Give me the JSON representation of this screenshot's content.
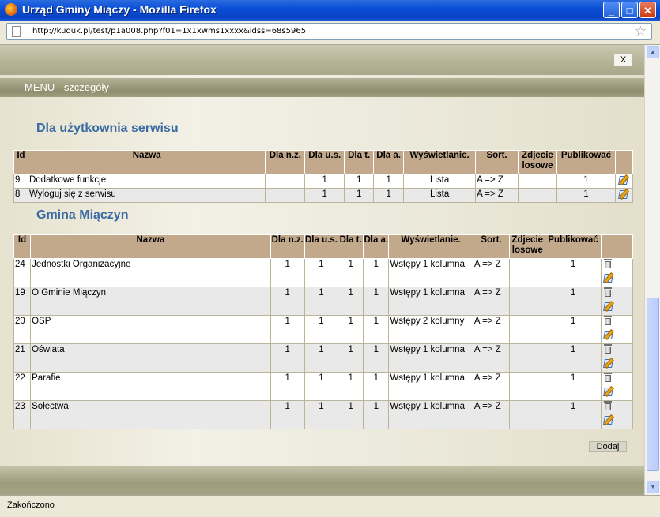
{
  "window": {
    "title": "Urząd Gminy Miączy - Mozilla Firefox",
    "url": "http://kuduk.pl/test/p1a008.php?f01=1x1xwms1xxxx&idss=68s5965",
    "status": "Zakończono",
    "min_label": "_",
    "max_label": "□",
    "close_label": "✕"
  },
  "page": {
    "close_label": "X",
    "menu_title": "MENU - szczegóły",
    "add_label": "Dodaj"
  },
  "section1": {
    "title": "Dla użytkownia serwisu",
    "headers": [
      "Id",
      "Nazwa",
      "Dla n.z.",
      "Dla u.s.",
      "Dla t.",
      "Dla a.",
      "Wyświetlanie.",
      "Sort.",
      "Zdjecie losowe",
      "Publikować",
      ""
    ],
    "rows": [
      {
        "id": "9",
        "name": "Dodatkowe funkcje",
        "nz": "",
        "us": "1",
        "t": "1",
        "a": "1",
        "display": "Lista",
        "sort": "A => Z",
        "random": "",
        "publish": "1"
      },
      {
        "id": "8",
        "name": "Wyloguj się z serwisu",
        "nz": "",
        "us": "1",
        "t": "1",
        "a": "1",
        "display": "Lista",
        "sort": "A => Z",
        "random": "",
        "publish": "1"
      }
    ]
  },
  "section2": {
    "title": "Gmina Miączyn",
    "headers": [
      "Id",
      "Nazwa",
      "Dla n.z.",
      "Dla u.s.",
      "Dla t.",
      "Dla a.",
      "Wyświetlanie.",
      "Sort.",
      "Zdjecie losowe",
      "Publikować",
      ""
    ],
    "rows": [
      {
        "id": "24",
        "name": "Jednostki Organizacyjne",
        "nz": "1",
        "us": "1",
        "t": "1",
        "a": "1",
        "display": "Wstępy 1 kolumna",
        "sort": "A => Z",
        "random": "",
        "publish": "1"
      },
      {
        "id": "19",
        "name": "O Gminie Miączyn",
        "nz": "1",
        "us": "1",
        "t": "1",
        "a": "1",
        "display": "Wstępy 1 kolumna",
        "sort": "A => Z",
        "random": "",
        "publish": "1"
      },
      {
        "id": "20",
        "name": "OSP",
        "nz": "1",
        "us": "1",
        "t": "1",
        "a": "1",
        "display": "Wstępy 2 kolumny",
        "sort": "A => Z",
        "random": "",
        "publish": "1"
      },
      {
        "id": "21",
        "name": "Oświata",
        "nz": "1",
        "us": "1",
        "t": "1",
        "a": "1",
        "display": "Wstępy 1 kolumna",
        "sort": "A => Z",
        "random": "",
        "publish": "1"
      },
      {
        "id": "22",
        "name": "Parafie",
        "nz": "1",
        "us": "1",
        "t": "1",
        "a": "1",
        "display": "Wstępy 1 kolumna",
        "sort": "A => Z",
        "random": "",
        "publish": "1"
      },
      {
        "id": "23",
        "name": "Sołectwa",
        "nz": "1",
        "us": "1",
        "t": "1",
        "a": "1",
        "display": "Wstępy 1 kolumna",
        "sort": "A => Z",
        "random": "",
        "publish": "1"
      }
    ]
  }
}
